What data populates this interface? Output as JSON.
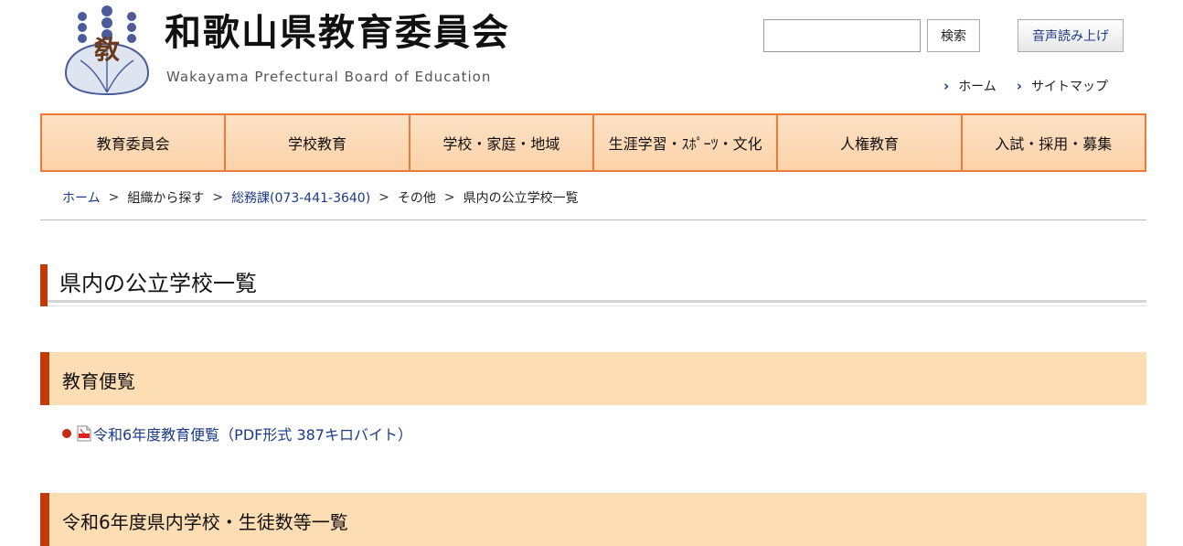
{
  "header": {
    "title": "和歌山県教育委員会",
    "subtitle": "Wakayama Prefectural Board of Education",
    "logo_char": "敎",
    "search": {
      "value": "",
      "placeholder": "",
      "button_label": "検索"
    },
    "voice_button_label": "音声読み上げ",
    "util_links": [
      {
        "label": "ホーム",
        "icon": "chevron-right-icon"
      },
      {
        "label": "サイトマップ",
        "icon": "chevron-right-icon"
      }
    ]
  },
  "nav": {
    "items": [
      {
        "label": "教育委員会"
      },
      {
        "label": "学校教育"
      },
      {
        "label": "学校・家庭・地域"
      },
      {
        "label": "生涯学習・ｽﾎﾟｰﾂ・文化"
      },
      {
        "label": "人権教育"
      },
      {
        "label": "入試・採用・募集"
      }
    ]
  },
  "breadcrumb": {
    "items": [
      {
        "label": "ホーム"
      },
      {
        "label": "組織から探す"
      },
      {
        "label": "総務課(073-441-3640)"
      },
      {
        "label": "その他"
      },
      {
        "label": "県内の公立学校一覧"
      }
    ],
    "separator": ">"
  },
  "main": {
    "page_title": "県内の公立学校一覧",
    "sections": [
      {
        "heading": "教育便覧",
        "links": [
          {
            "label": "令和6年度教育便覧（PDF形式 387キロバイト）",
            "icon": "pdf-icon"
          }
        ]
      },
      {
        "heading": "令和6年度県内学校・生徒数等一覧"
      }
    ]
  },
  "colors": {
    "nav_border": "#ee7a3a",
    "nav_bg": "#fcd3a9",
    "accent": "#c03a0a",
    "section_bg": "#fdddb3",
    "link": "#1a3a8a",
    "bullet": "#c62a12"
  }
}
